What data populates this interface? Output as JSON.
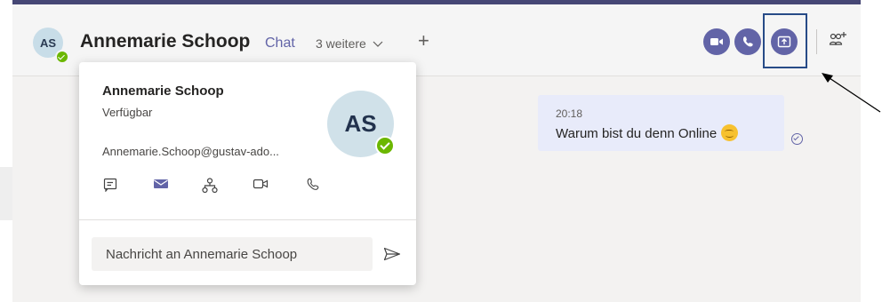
{
  "header": {
    "avatar_initials": "AS",
    "contact_name": "Annemarie Schoop",
    "chat_tab": "Chat",
    "more_tabs": "3 weitere",
    "add_tab": "+"
  },
  "message": {
    "time": "20:18",
    "text": "Warum bist du denn Online"
  },
  "profile_card": {
    "name": "Annemarie Schoop",
    "status": "Verfügbar",
    "email": "Annemarie.Schoop@gustav-ado...",
    "avatar_initials": "AS",
    "message_placeholder": "Nachricht an Annemarie Schoop"
  },
  "colors": {
    "accent": "#6264a7",
    "presence_available": "#6bb700",
    "highlight_box": "#274b87",
    "message_bubble": "#e8ebfa"
  },
  "icons": [
    "video-call-icon",
    "audio-call-icon",
    "share-screen-icon",
    "add-people-icon",
    "chat-icon",
    "mail-icon",
    "org-chart-icon",
    "video-icon",
    "phone-icon",
    "send-icon",
    "read-receipt-icon"
  ]
}
